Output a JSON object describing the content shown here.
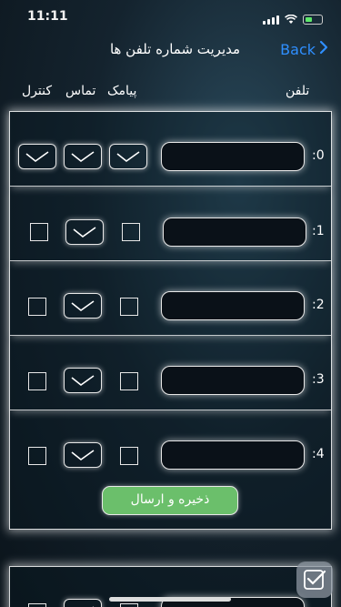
{
  "status": {
    "time": "11:11"
  },
  "header": {
    "title": "مدیریت شماره تلفن ها",
    "back_label": "Back"
  },
  "columns": {
    "phone": "تلفن",
    "sms": "پیامک",
    "call": "تماس",
    "control": "کنترل"
  },
  "rows": [
    {
      "label": ":0",
      "phone": ""
    },
    {
      "label": ":1",
      "phone": ""
    },
    {
      "label": ":2",
      "phone": ""
    },
    {
      "label": ":3",
      "phone": ""
    },
    {
      "label": ":4",
      "phone": ""
    }
  ],
  "save_button": "ذخیره و ارسال",
  "colors": {
    "accent": "#2f8fff",
    "save_green": "#6bbf6b"
  }
}
